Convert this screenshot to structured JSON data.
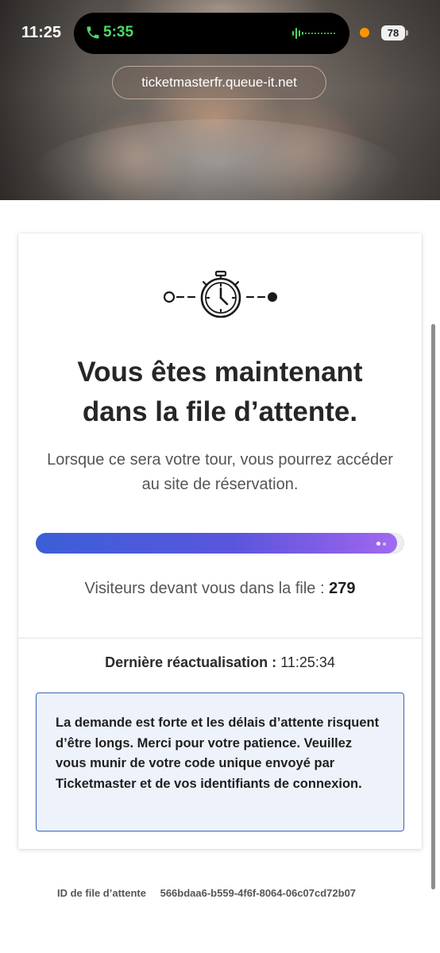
{
  "status_bar": {
    "time": "11:25",
    "call_timer": "5:35",
    "battery": "78"
  },
  "browser": {
    "url": "ticketmasterfr.queue-it.net"
  },
  "queue": {
    "headline_line1": "Vous êtes maintenant",
    "headline_line2": "dans la file d’attente.",
    "subtext": "Lorsque ce sera votre tour, vous pourrez accéder au site de réservation.",
    "progress_fraction": 0.98,
    "visitors_label": "Visiteurs devant vous dans la file :",
    "visitors_count": "279",
    "last_refresh_label": "Dernière réactualisation :",
    "last_refresh_time": "11:25:34",
    "notice": "La demande est forte et les délais d’attente risquent d’être longs. Merci pour votre patience. Veuillez vous munir de votre code unique envoyé par Ticketmaster et de vos identifiants de connexion.",
    "queue_id_label": "ID de file d’attente",
    "queue_id_value": "566bdaa6-b559-4f6f-8064-06c07cd72b07"
  },
  "icons": {
    "timer": "stopwatch-icon",
    "phone": "phone-icon"
  },
  "colors": {
    "progress_start": "#3b5fd6",
    "progress_end": "#a06bf0",
    "notice_border": "#3b63b8",
    "notice_bg": "#edf2fb",
    "call_green": "#4cd964"
  }
}
